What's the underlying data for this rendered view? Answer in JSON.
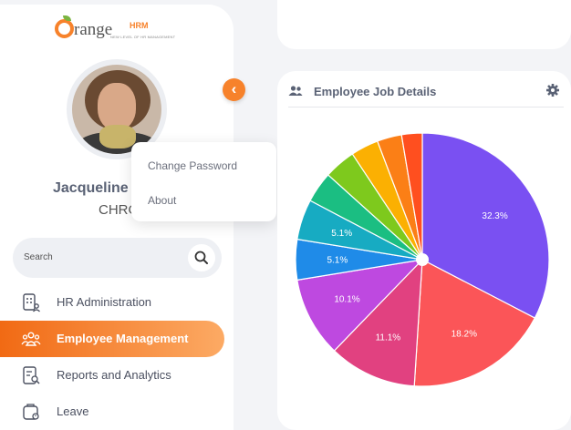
{
  "brand": {
    "name": "range",
    "suffix": "HRM",
    "tagline": "NEW LEVEL OF HR MANAGEMENT"
  },
  "user": {
    "name": "Jacqueline V",
    "role": "CHRO"
  },
  "dropdown": {
    "items": [
      "Change Password",
      "About"
    ]
  },
  "search": {
    "placeholder": "Search"
  },
  "nav": {
    "items": [
      {
        "label": "HR Administration",
        "icon": "hr-admin-icon",
        "active": false
      },
      {
        "label": "Employee Management",
        "icon": "employee-management-icon",
        "active": true
      },
      {
        "label": "Reports and Analytics",
        "icon": "reports-icon",
        "active": false
      },
      {
        "label": "Leave",
        "icon": "leave-icon",
        "active": false
      }
    ]
  },
  "card": {
    "title": "Employee Job Details"
  },
  "colors": {
    "accent": "#f7822b",
    "nav_active_start": "#f16a14",
    "nav_active_end": "#fcaa64"
  },
  "chart_data": {
    "type": "pie",
    "slices": [
      {
        "value": 32.3,
        "label": "32.3%",
        "color": "#7a50f2"
      },
      {
        "value": 18.2,
        "label": "18.2%",
        "color": "#fb5558"
      },
      {
        "value": 11.1,
        "label": "11.1%",
        "color": "#e14180"
      },
      {
        "value": 10.1,
        "label": "10.1%",
        "color": "#be49e0"
      },
      {
        "value": 5.1,
        "label": "5.1%",
        "color": "#1f8be8"
      },
      {
        "value": 5.1,
        "label": "5.1%",
        "color": "#17abc2"
      },
      {
        "value": 3.9,
        "label": "",
        "color": "#1bbe82"
      },
      {
        "value": 4.0,
        "label": "",
        "color": "#7ec91d"
      },
      {
        "value": 3.5,
        "label": "",
        "color": "#fbb002"
      },
      {
        "value": 3.1,
        "label": "",
        "color": "#fb7f16"
      },
      {
        "value": 2.6,
        "label": "",
        "color": "#ff4f1f"
      }
    ]
  }
}
